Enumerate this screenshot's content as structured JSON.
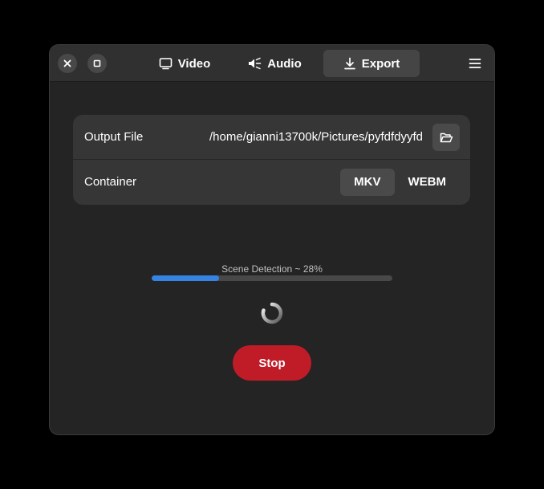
{
  "headerbar": {
    "tabs": [
      {
        "label": "Video",
        "icon": "monitor-icon",
        "active": false
      },
      {
        "label": "Audio",
        "icon": "speaker-icon",
        "active": false
      },
      {
        "label": "Export",
        "icon": "download-icon",
        "active": true
      }
    ],
    "window_buttons": [
      "close-icon",
      "maximize-icon"
    ],
    "menu_icon": "hamburger-menu-icon"
  },
  "export": {
    "output_file": {
      "label": "Output File",
      "path": "/home/gianni13700k/Pictures/pyfdfdyyfd",
      "icon": "folder-open-icon"
    },
    "container": {
      "label": "Container",
      "options": [
        "MKV",
        "WEBM"
      ],
      "selected": "MKV"
    }
  },
  "progress": {
    "label": "Scene Detection ~ 28%",
    "fraction": 0.28
  },
  "stop_button": {
    "label": "Stop",
    "color": "#c01c28"
  },
  "colors": {
    "accent": "#3584e4",
    "destructive": "#c01c28"
  }
}
